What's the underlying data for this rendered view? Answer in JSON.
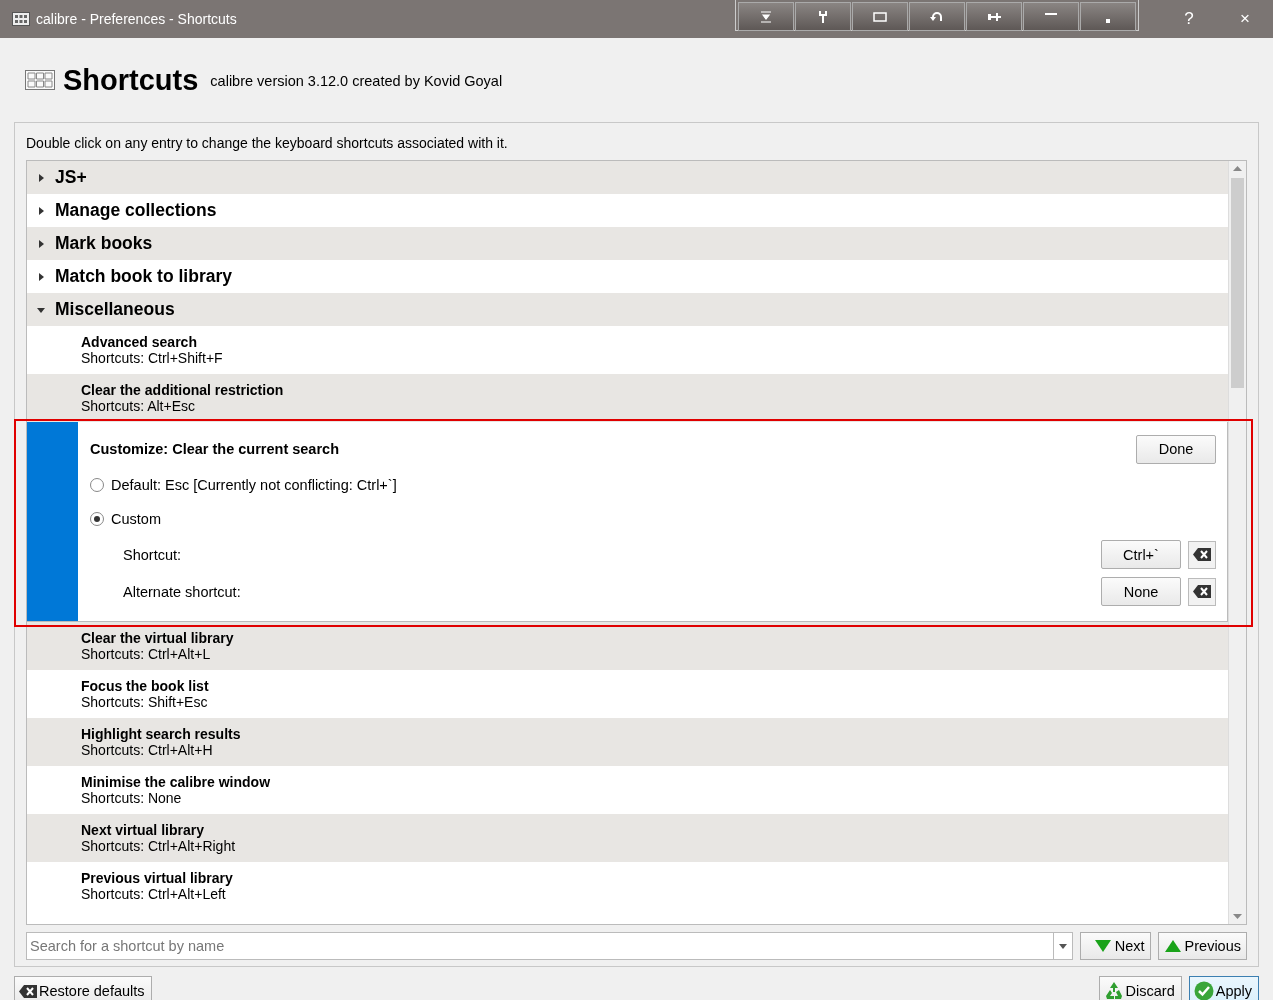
{
  "window": {
    "title": "calibre - Preferences - Shortcuts",
    "help": "?",
    "close": "×"
  },
  "header": {
    "title": "Shortcuts",
    "subtitle": "calibre version 3.12.0 created by Kovid Goyal"
  },
  "instructions": "Double click on any entry to change the keyboard shortcuts associated with it.",
  "tree": [
    {
      "kind": "group",
      "label": "JS+",
      "expanded": false
    },
    {
      "kind": "group",
      "label": "Manage collections",
      "expanded": false
    },
    {
      "kind": "group",
      "label": "Mark books",
      "expanded": false
    },
    {
      "kind": "group",
      "label": "Match book to library",
      "expanded": false
    },
    {
      "kind": "group",
      "label": "Miscellaneous",
      "expanded": true,
      "children": [
        {
          "kind": "shortcut",
          "name": "Advanced search",
          "shortcuts": "Shortcuts: Ctrl+Shift+F"
        },
        {
          "kind": "shortcut",
          "name": "Clear the additional restriction",
          "shortcuts": "Shortcuts: Alt+Esc"
        },
        {
          "kind": "editor",
          "title": "Customize: Clear the current search",
          "done": "Done",
          "options": [
            {
              "label": "Default: Esc [Currently not conflicting: Ctrl+`]",
              "selected": false
            },
            {
              "label": "Custom",
              "selected": true
            }
          ],
          "fields": [
            {
              "label": "Shortcut:",
              "value": "Ctrl+`"
            },
            {
              "label": "Alternate shortcut:",
              "value": "None"
            }
          ]
        },
        {
          "kind": "shortcut",
          "name": "Clear the virtual library",
          "shortcuts": "Shortcuts: Ctrl+Alt+L"
        },
        {
          "kind": "shortcut",
          "name": "Focus the book list",
          "shortcuts": "Shortcuts: Shift+Esc"
        },
        {
          "kind": "shortcut",
          "name": "Highlight search results",
          "shortcuts": "Shortcuts: Ctrl+Alt+H"
        },
        {
          "kind": "shortcut",
          "name": "Minimise the calibre window",
          "shortcuts": "Shortcuts: None"
        },
        {
          "kind": "shortcut",
          "name": "Next virtual library",
          "shortcuts": "Shortcuts: Ctrl+Alt+Right"
        },
        {
          "kind": "shortcut",
          "name": "Previous virtual library",
          "shortcuts": "Shortcuts: Ctrl+Alt+Left"
        }
      ]
    }
  ],
  "search": {
    "placeholder": "Search for a shortcut by name",
    "next": "Next",
    "previous": "Previous"
  },
  "footer": {
    "restore": "Restore defaults",
    "discard": "Discard",
    "apply": "Apply"
  }
}
